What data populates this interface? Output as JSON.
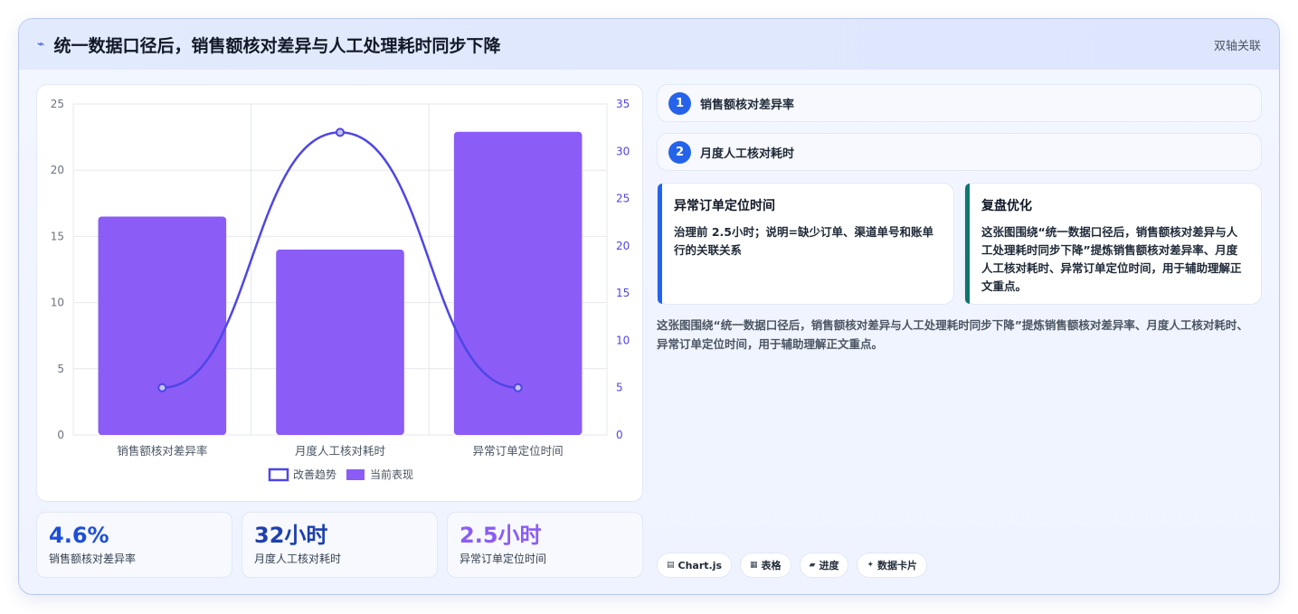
{
  "header": {
    "icon": "⌁",
    "title": "统一数据口径后，销售额核对差异与人工处理耗时同步下降",
    "tag": "双轴关联"
  },
  "chart_data": {
    "type": "bar",
    "categories": [
      "销售额核对差异率",
      "月度人工核对耗时",
      "异常订单定位时间"
    ],
    "series": [
      {
        "name": "当前表现",
        "type": "bar",
        "axis": "left",
        "values": [
          16.5,
          14,
          22.9
        ],
        "color": "#8b5cf6"
      },
      {
        "name": "改善趋势",
        "type": "line",
        "axis": "right",
        "values": [
          5,
          32,
          5
        ],
        "color": "#4f46e5"
      }
    ],
    "y_left": {
      "min": 0,
      "max": 25,
      "ticks": [
        "0",
        "5",
        "10",
        "15",
        "20",
        "25"
      ]
    },
    "y_right": {
      "min": 0,
      "max": 35,
      "ticks": [
        "0",
        "5",
        "10",
        "15",
        "20",
        "25",
        "30",
        "35"
      ]
    },
    "grid": true,
    "legend": "bottom"
  },
  "stats": [
    {
      "value": "4.6%",
      "label": "销售额核对差异率",
      "color": "#1d4ed8"
    },
    {
      "value": "32小时",
      "label": "月度人工核对耗时",
      "color": "#1e40af"
    },
    {
      "value": "2.5小时",
      "label": "异常订单定位时间",
      "color": "#8b5cf6"
    }
  ],
  "items": [
    {
      "num": "1",
      "label": "销售额核对差异率"
    },
    {
      "num": "2",
      "label": "月度人工核对耗时"
    }
  ],
  "cards": [
    {
      "title": "异常订单定位时间",
      "body": "治理前 2.5小时；说明=缺少订单、渠道单号和账单行的关联关系",
      "accent": "#2563eb"
    },
    {
      "title": "复盘优化",
      "body": "这张图围绕“统一数据口径后，销售额核对差异与人工处理耗时同步下降”提炼销售额核对差异率、月度人工核对耗时、异常订单定位时间，用于辅助理解正文重点。",
      "accent": "#0f766e"
    }
  ],
  "description": "这张图围绕“统一数据口径后，销售额核对差异与人工处理耗时同步下降”提炼销售额核对差异率、月度人工核对耗时、异常订单定位时间，用于辅助理解正文重点。",
  "chips": [
    {
      "icon": "▤",
      "label": "Chart.js"
    },
    {
      "icon": "▦",
      "label": "表格"
    },
    {
      "icon": "▰",
      "label": "进度"
    },
    {
      "icon": "✦",
      "label": "数据卡片"
    }
  ]
}
